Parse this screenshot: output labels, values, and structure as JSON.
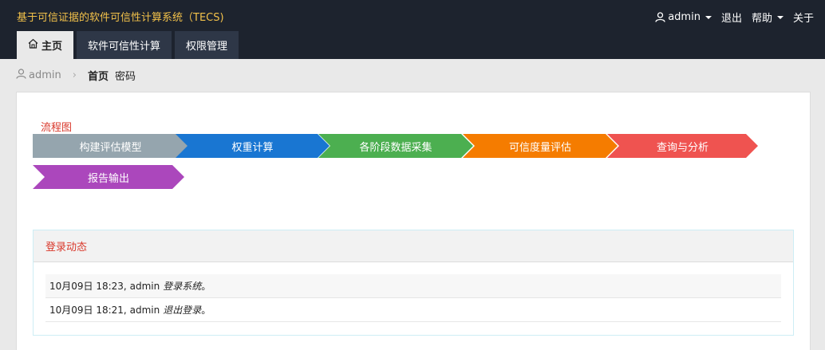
{
  "header": {
    "app_title": "基于可信证据的软件可信性计算系统（TECS)",
    "user_label": "admin",
    "logout_label": "退出",
    "help_label": "帮助",
    "about_label": "关于"
  },
  "tabs": [
    {
      "label": "主页",
      "active": true
    },
    {
      "label": "软件可信性计算",
      "active": false
    },
    {
      "label": "权限管理",
      "active": false
    }
  ],
  "breadcrumb": {
    "user": "admin",
    "home": "首页",
    "password": "密码"
  },
  "flow": {
    "title": "流程图",
    "steps": [
      {
        "label": "构建评估模型",
        "color": "#95a5ae"
      },
      {
        "label": "权重计算",
        "color": "#1976d2"
      },
      {
        "label": "各阶段数据采集",
        "color": "#4caf50"
      },
      {
        "label": "可信度量评估",
        "color": "#f57c00"
      },
      {
        "label": "查询与分析",
        "color": "#ef5350"
      },
      {
        "label": "报告输出",
        "color": "#ab47bc"
      }
    ]
  },
  "activity": {
    "title": "登录动态",
    "items": [
      {
        "time": "10月09日 18:23,",
        "user": "admin",
        "action": "登录系统",
        "end": "。"
      },
      {
        "time": "10月09日 18:21,",
        "user": "admin",
        "action": "退出登录",
        "end": "。"
      }
    ]
  }
}
